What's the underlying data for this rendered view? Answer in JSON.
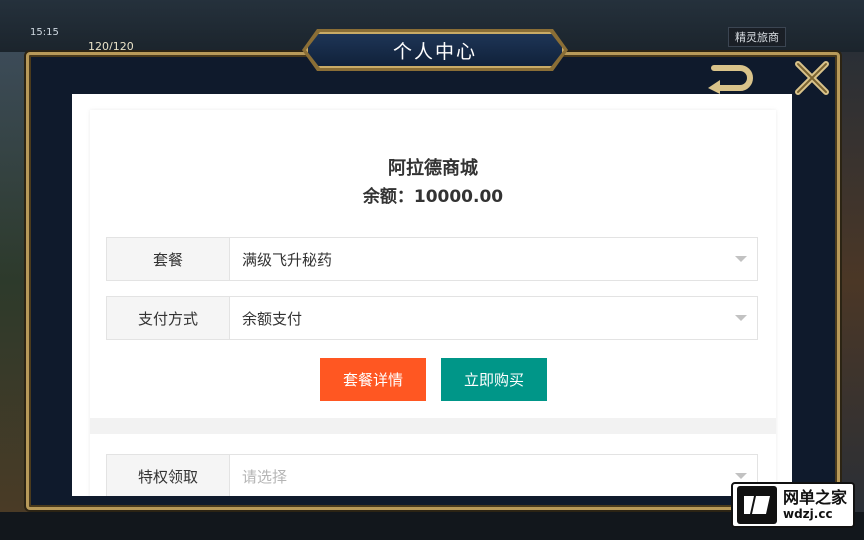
{
  "status_bar": {
    "time": "15:15",
    "energy": "120/120"
  },
  "hud": {
    "guide_label": "精灵旅商"
  },
  "dialog": {
    "title": "个人中心"
  },
  "store": {
    "name": "阿拉德商城",
    "balance": "余额：10000.00"
  },
  "form": {
    "package": {
      "label": "套餐",
      "value": "满级飞升秘药"
    },
    "payment": {
      "label": "支付方式",
      "value": "余额支付"
    },
    "privilege": {
      "label": "特权领取",
      "placeholder": "请选择"
    }
  },
  "buttons": {
    "detail_label": "套餐详情",
    "buy_label": "立即购买"
  },
  "colors": {
    "detail_button": "#ff5722",
    "buy_button": "#009688",
    "frame_gold": "#b89a5a",
    "frame_navy": "#0f1a2c"
  },
  "watermark": {
    "cn": "网单之家",
    "en": "wdzj.cc"
  }
}
